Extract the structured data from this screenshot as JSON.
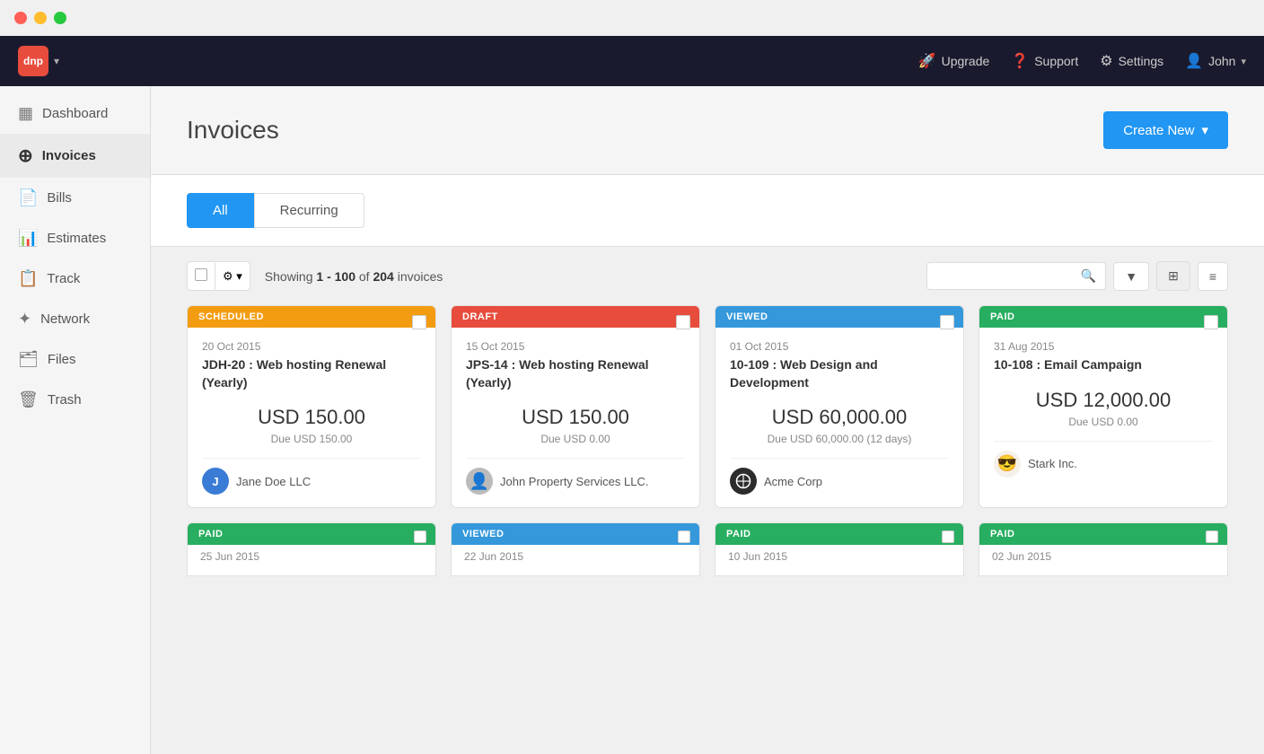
{
  "titlebar": {
    "btn_close": "close",
    "btn_min": "minimize",
    "btn_max": "maximize"
  },
  "topnav": {
    "logo_text": "dnp",
    "upgrade_label": "Upgrade",
    "support_label": "Support",
    "settings_label": "Settings",
    "user_label": "John"
  },
  "sidebar": {
    "items": [
      {
        "id": "dashboard",
        "label": "Dashboard",
        "icon": "▦"
      },
      {
        "id": "invoices",
        "label": "Invoices",
        "icon": "＋"
      },
      {
        "id": "bills",
        "label": "Bills",
        "icon": "🗒"
      },
      {
        "id": "estimates",
        "label": "Estimates",
        "icon": "📈"
      },
      {
        "id": "track",
        "label": "Track",
        "icon": "📋"
      },
      {
        "id": "network",
        "label": "Network",
        "icon": "✦"
      },
      {
        "id": "files",
        "label": "Files",
        "icon": "🗂"
      },
      {
        "id": "trash",
        "label": "Trash",
        "icon": "🗑"
      }
    ]
  },
  "page": {
    "title": "Invoices",
    "create_new_label": "Create New"
  },
  "tabs": [
    {
      "id": "all",
      "label": "All",
      "active": true
    },
    {
      "id": "recurring",
      "label": "Recurring",
      "active": false
    }
  ],
  "toolbar": {
    "showing_prefix": "Showing",
    "showing_range": "1 - 100",
    "showing_of": "of",
    "showing_total": "204",
    "showing_suffix": "invoices",
    "search_placeholder": ""
  },
  "cards": [
    {
      "status": "SCHEDULED",
      "status_class": "status-scheduled",
      "date": "20 Oct 2015",
      "id_title": "JDH-20 : Web hosting Renewal (Yearly)",
      "amount": "USD 150.00",
      "due": "Due USD 150.00",
      "client_name": "Jane Doe LLC",
      "client_avatar_type": "letter",
      "client_avatar_letter": "J",
      "client_avatar_class": "avatar-j"
    },
    {
      "status": "DRAFT",
      "status_class": "status-draft",
      "date": "15 Oct 2015",
      "id_title": "JPS-14 : Web hosting Renewal (Yearly)",
      "amount": "USD 150.00",
      "due": "Due USD 0.00",
      "client_name": "John Property Services LLC.",
      "client_avatar_type": "photo",
      "client_avatar_class": "avatar-img"
    },
    {
      "status": "VIEWED",
      "status_class": "status-viewed",
      "date": "01 Oct 2015",
      "id_title": "10-109 : Web Design and Development",
      "amount": "USD 60,000.00",
      "due": "Due USD 60,000.00 (12 days)",
      "client_name": "Acme Corp",
      "client_avatar_type": "logo",
      "client_avatar_class": "avatar-dark"
    },
    {
      "status": "PAID",
      "status_class": "status-paid",
      "date": "31 Aug 2015",
      "id_title": "10-108 : Email Campaign",
      "amount": "USD 12,000.00",
      "due": "Due USD 0.00",
      "client_name": "Stark Inc.",
      "client_avatar_type": "emoji",
      "client_avatar_class": "avatar-emoji"
    }
  ],
  "bottom_cards": [
    {
      "status": "PAID",
      "status_class": "status-paid",
      "date": "25 Jun 2015"
    },
    {
      "status": "VIEWED",
      "status_class": "status-viewed",
      "date": "22 Jun 2015"
    },
    {
      "status": "PAID",
      "status_class": "status-paid",
      "date": "10 Jun 2015"
    },
    {
      "status": "PAID",
      "status_class": "status-paid",
      "date": "02 Jun 2015"
    }
  ]
}
